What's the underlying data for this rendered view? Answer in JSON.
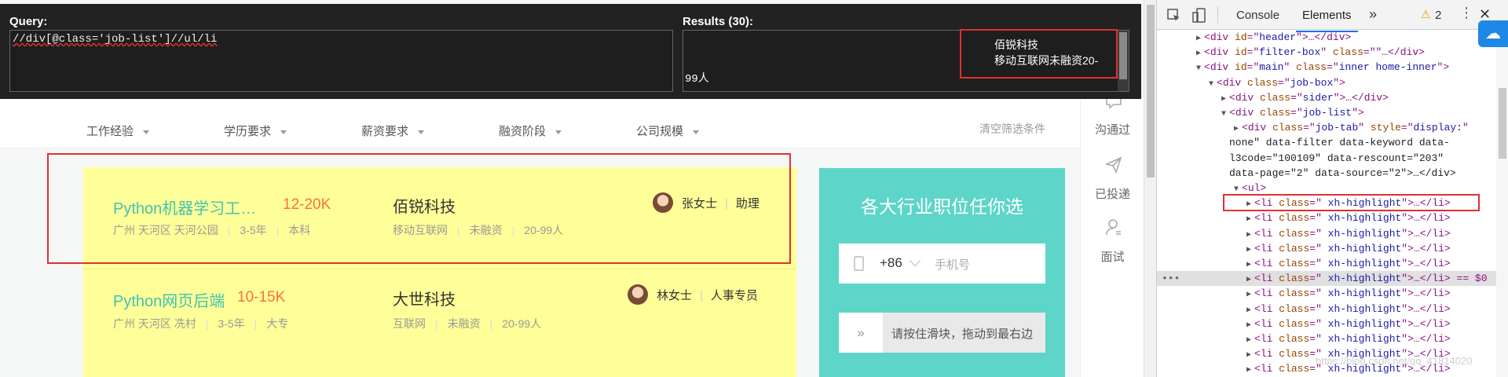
{
  "xpath_helper": {
    "query_label": "Query:",
    "query": "//div[@class='job-list']//ul/li",
    "results_label": "Results (30):",
    "result_overflow": "99人",
    "result_line1": "佰锐科技",
    "result_line2": "移动互联网未融资20-"
  },
  "filters": {
    "items": [
      "工作经验",
      "学历要求",
      "薪资要求",
      "融资阶段",
      "公司规模"
    ],
    "clear": "清空筛选条件"
  },
  "jobs": [
    {
      "title": "Python机器学习工…",
      "salary": "12-20K",
      "location": "广州 天河区 天河公园",
      "experience": "3-5年",
      "education": "本科",
      "company": "佰锐科技",
      "industry": "移动互联网",
      "funding": "未融资",
      "size": "20-99人",
      "recruiter": "张女士",
      "recruiter_title": "助理"
    },
    {
      "title": "Python网页后端",
      "salary": "10-15K",
      "location": "广州 天河区 冼村",
      "experience": "3-5年",
      "education": "大专",
      "company": "大世科技",
      "industry": "互联网",
      "funding": "未融资",
      "size": "20-99人",
      "recruiter": "林女士",
      "recruiter_title": "人事专员"
    }
  ],
  "promo": {
    "title": "各大行业职位任你选",
    "country_code": "+86",
    "phone_placeholder": "手机号",
    "slider_handle": "»",
    "slider_text": "请按住滑块，拖动到最右边"
  },
  "sidebar": {
    "items": [
      "沟通过",
      "已投递",
      "面试"
    ]
  },
  "devtools": {
    "tabs": [
      "Console",
      "Elements"
    ],
    "more": "»",
    "warnings": "2",
    "close": "✕",
    "tree": [
      {
        "tag": "<div ",
        "attrs": [
          [
            "id",
            "header"
          ]
        ],
        "tail": ">…</div>"
      },
      {
        "tag": "<div ",
        "attrs": [
          [
            "id",
            "filter-box"
          ],
          [
            "class",
            ""
          ]
        ],
        "tail": "…</div>"
      },
      {
        "tag": "<div ",
        "attrs": [
          [
            "id",
            "main"
          ],
          [
            "class",
            "inner home-inner"
          ]
        ],
        "tail": ">"
      },
      {
        "tag": "<div ",
        "attrs": [
          [
            "class",
            "job-box"
          ]
        ],
        "tail": ">"
      },
      {
        "tag": "<div ",
        "attrs": [
          [
            "class",
            "sider"
          ]
        ],
        "tail": ">…</div>"
      },
      {
        "tag": "<div ",
        "attrs": [
          [
            "class",
            "job-list"
          ]
        ],
        "tail": ">"
      },
      {
        "tag": "<div ",
        "attrs": [
          [
            "class",
            "job-tab"
          ],
          [
            "style",
            "display:"
          ]
        ],
        "tail": ""
      },
      {
        "text": "none\" data-filter data-keyword data-"
      },
      {
        "text": "l3code=\"100109\" data-rescount=\"203\""
      },
      {
        "text": "data-page=\"2\" data-source=\"2\">…</div>"
      },
      {
        "tag": "<ul>",
        "attrs": [],
        "tail": ""
      },
      {
        "tag": "<li ",
        "attrs": [
          [
            "class",
            " xh-highlight"
          ]
        ],
        "tail": ">…</li>"
      },
      {
        "tag": "<li ",
        "attrs": [
          [
            "class",
            " xh-highlight"
          ]
        ],
        "tail": ">…</li>"
      },
      {
        "tag": "<li ",
        "attrs": [
          [
            "class",
            " xh-highlight"
          ]
        ],
        "tail": ">…</li>"
      },
      {
        "tag": "<li ",
        "attrs": [
          [
            "class",
            " xh-highlight"
          ]
        ],
        "tail": ">…</li>"
      },
      {
        "tag": "<li ",
        "attrs": [
          [
            "class",
            " xh-highlight"
          ]
        ],
        "tail": ">…</li>"
      },
      {
        "tag": "<li ",
        "attrs": [
          [
            "class",
            " xh-highlight"
          ]
        ],
        "tail": ">…</li> == $0"
      },
      {
        "tag": "<li ",
        "attrs": [
          [
            "class",
            " xh-highlight"
          ]
        ],
        "tail": ">…</li>"
      },
      {
        "tag": "<li ",
        "attrs": [
          [
            "class",
            " xh-highlight"
          ]
        ],
        "tail": ">…</li>"
      },
      {
        "tag": "<li ",
        "attrs": [
          [
            "class",
            " xh-highlight"
          ]
        ],
        "tail": ">…</li>"
      },
      {
        "tag": "<li ",
        "attrs": [
          [
            "class",
            " xh-highlight"
          ]
        ],
        "tail": ">…</li>"
      },
      {
        "tag": "<li ",
        "attrs": [
          [
            "class",
            " xh-highlight"
          ]
        ],
        "tail": ">…</li>"
      },
      {
        "tag": "<li ",
        "attrs": [
          [
            "class",
            " xh-highlight"
          ]
        ],
        "tail": ">…</li>"
      }
    ],
    "dots": "•••"
  },
  "watermark": "https://blog.csdn.net/qq_41814020",
  "colors": {
    "job_title": "#41c2b0",
    "salary": "#fc703e",
    "card_highlight": "#ffff99",
    "promo_bg": "#5dd5c8",
    "red_box": "#e03030"
  }
}
